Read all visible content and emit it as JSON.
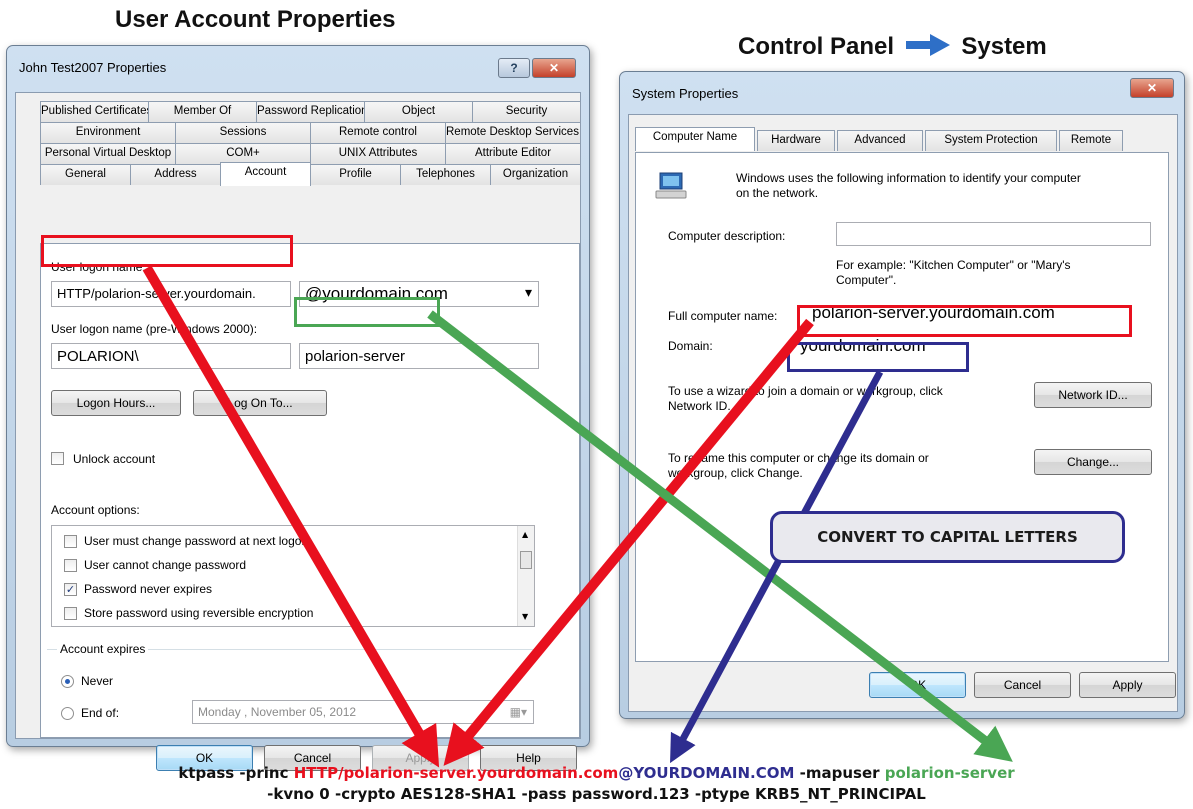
{
  "headings": {
    "left": "User Account Properties",
    "right_start": "Control Panel",
    "right_end": "System"
  },
  "user_window": {
    "title": "John Test2007 Properties",
    "help_glyph": "?",
    "close_glyph": "✕",
    "tab_rows": [
      [
        "Published Certificates",
        "Member Of",
        "Password Replication",
        "Object",
        "Security"
      ],
      [
        "Environment",
        "Sessions",
        "Remote control",
        "Remote Desktop Services Profile"
      ],
      [
        "Personal Virtual Desktop",
        "COM+",
        "UNIX Attributes",
        "Attribute Editor"
      ],
      [
        "General",
        "Address",
        "Account",
        "Profile",
        "Telephones",
        "Organization"
      ]
    ],
    "logon_name_label": "User logon name:",
    "logon_name_value": "HTTP/polarion-server.yourdomain.",
    "domain_suffix": "@yourdomain.com",
    "dropdown_glyph": "▾",
    "pre2000_label": "User logon name (pre-Windows 2000):",
    "pre2000_domain": "POLARION\\",
    "pre2000_user": "polarion-server",
    "logon_hours_button": "Logon Hours...",
    "log_on_to_button": "Log On To...",
    "unlock_label": "Unlock account",
    "account_options_label": "Account options:",
    "options": [
      {
        "label": "User must change password at next logon",
        "checked": false
      },
      {
        "label": "User cannot change password",
        "checked": false
      },
      {
        "label": "Password never expires",
        "checked": true
      },
      {
        "label": "Store password using reversible encryption",
        "checked": false
      }
    ],
    "check_glyph": "✓",
    "account_expires_label": "Account expires",
    "never_label": "Never",
    "end_of_label": "End of:",
    "end_of_date": "Monday   , November 05, 2012",
    "calendar_glyph": "▦▾",
    "ok_button": "OK",
    "cancel_button": "Cancel",
    "apply_button": "Apply",
    "help_button": "Help"
  },
  "system_window": {
    "title": "System Properties",
    "close_glyph": "✕",
    "tabs": [
      "Computer Name",
      "Hardware",
      "Advanced",
      "System Protection",
      "Remote"
    ],
    "info_text_1": "Windows uses the following information to identify your computer",
    "info_text_2": "on the network.",
    "description_label": "Computer description:",
    "example_text_1": "For example: \"Kitchen Computer\" or \"Mary's",
    "example_text_2": "Computer\".",
    "full_name_label": "Full computer name:",
    "full_name_value": "polarion-server.yourdomain.com",
    "domain_label": "Domain:",
    "domain_value": "yourdomain.com",
    "wizard_text_1": "To use a wizard to join a domain or workgroup, click",
    "wizard_text_2": "Network ID.",
    "network_id_button": "Network ID...",
    "rename_text_1": "To rename this computer or change its domain or",
    "rename_text_2": "workgroup, click Change.",
    "change_button": "Change...",
    "ok_button": "OK",
    "cancel_button": "Cancel",
    "apply_button": "Apply"
  },
  "callout": {
    "text": "CONVERT TO CAPITAL LETTERS"
  },
  "command": {
    "line1": {
      "prefix": "ktpass -princ ",
      "principal": "HTTP/polarion-server.yourdomain.com",
      "realm": "@YOURDOMAIN.COM",
      "mapuser_flag": " -mapuser ",
      "mapuser": "polarion-server"
    },
    "line2": "-kvno 0 -crypto AES128-SHA1 -pass password.123 -ptype KRB5_NT_PRINCIPAL"
  },
  "colors": {
    "red": "#e8101e",
    "green": "#4aa654",
    "navy": "#2e2d8f"
  }
}
